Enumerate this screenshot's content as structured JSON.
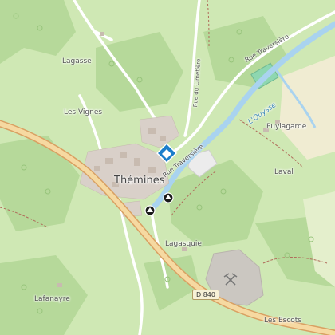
{
  "map": {
    "places": {
      "lagasse": "Lagasse",
      "les_vignes": "Les Vignes",
      "themines": "Thémines",
      "puylagarde": "Puylagarde",
      "laval": "Laval",
      "lagasquie": "Lagasquie",
      "lafanayre": "Lafanayre",
      "les_escots": "Les Escots"
    },
    "roads": {
      "rue_traversiere_north": "Rue Traversière",
      "rue_traversiere_town": "Rue Traversière",
      "rue_du_cimetiere": "Rue du Cimetière",
      "d840": "D 840"
    },
    "water": {
      "river": "L'Ouysse"
    },
    "colors": {
      "meadow": "#cfe8b4",
      "forest": "#b6d99a",
      "road_major": "#f6d9a1",
      "road_casing": "#d9a062",
      "road_minor": "#ffffff",
      "river": "#a9d3ef",
      "buildings": "#d9d0c9",
      "quarry": "#cbc7c1",
      "pitch": "#8ed7b0",
      "poi_blue": "#1b7ecb"
    },
    "icons": [
      "information-icon",
      "cave-icon",
      "mine-icon"
    ]
  }
}
